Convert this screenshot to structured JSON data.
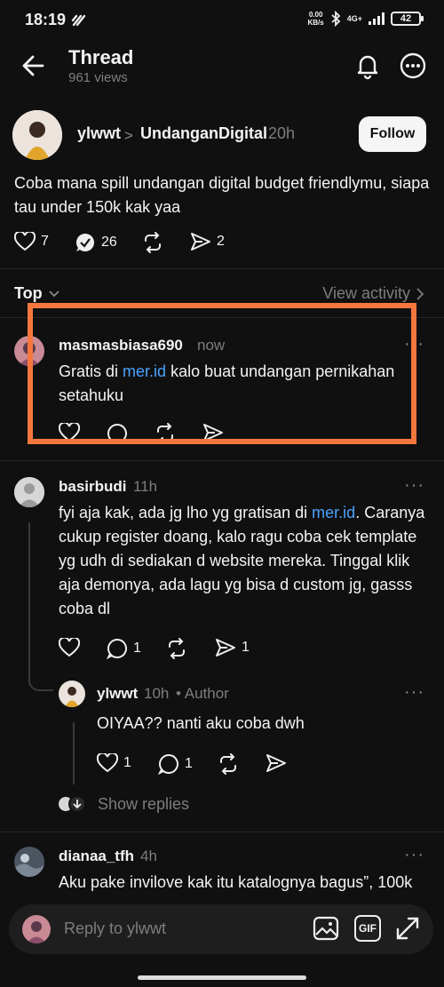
{
  "status_bar": {
    "time": "18:19",
    "net_speed": "0.00\nKB/s",
    "network": "4G+",
    "battery": "42"
  },
  "header": {
    "title": "Thread",
    "views": "961 views"
  },
  "post": {
    "username": "ylwwt",
    "separator": ">",
    "community": "UndanganDigital",
    "time": "20h",
    "follow_label": "Follow",
    "text": "Coba mana spill undangan digital budget friendlymu, siapa tau under 150k kak yaa",
    "likes": "7",
    "comments": "26",
    "shares": "2"
  },
  "sort": {
    "label": "Top",
    "view_activity": "View activity"
  },
  "comments": [
    {
      "username": "masmasbiasa690",
      "time": "now",
      "text_before": "Gratis di ",
      "link": "mer.id",
      "text_after": " kalo buat undangan pernikahan setahuku"
    },
    {
      "username": "basirbudi",
      "time": "11h",
      "text_before": "fyi aja kak, ada jg lho yg gratisan di ",
      "link": "mer.id",
      "text_after": ". Caranya cukup register doang, kalo ragu coba cek template yg udh di sediakan d website mereka. Tinggal klik aja demonya, ada lagu yg bisa d custom jg, gasss coba dl",
      "comments": "1",
      "shares": "1"
    },
    {
      "username": "ylwwt",
      "time": "10h",
      "author_label": "• Author",
      "text": "OIYAA?? nanti aku coba dwh",
      "likes": "1",
      "comments": "1"
    },
    {
      "username": "dianaa_tfh",
      "time": "4h",
      "text": "Aku pake invilove kak itu katalognya bagus”, 100k"
    }
  ],
  "show_replies": "Show replies",
  "reply_bar": {
    "placeholder": "Reply to ylwwt",
    "gif_label": "GIF"
  },
  "colors": {
    "background": "#101010",
    "link": "#4aa3ff",
    "highlight": "#f5773d"
  }
}
